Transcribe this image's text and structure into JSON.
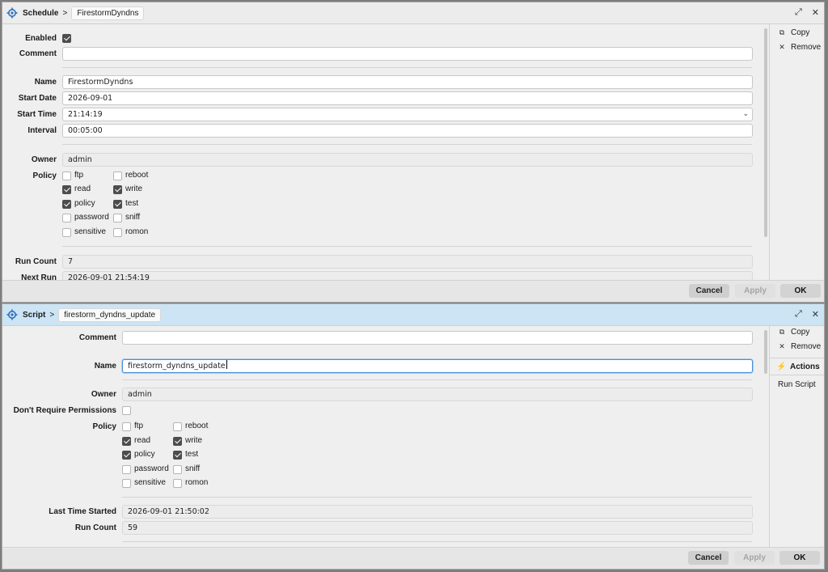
{
  "win1": {
    "path_root": "Schedule",
    "path_sep": ">",
    "path_item": "FirestormDyndns",
    "labels": {
      "enabled": "Enabled",
      "comment": "Comment",
      "name": "Name",
      "start_date": "Start Date",
      "start_time": "Start Time",
      "interval": "Interval",
      "owner": "Owner",
      "policy": "Policy",
      "run_count": "Run Count",
      "next_run": "Next Run"
    },
    "values": {
      "comment": "",
      "name": "FirestormDyndns",
      "start_date": "2026-09-01",
      "start_time": "21:14:19",
      "interval": "00:05:00",
      "owner": "admin",
      "run_count": "7",
      "next_run": "2026-09-01 21:54:19"
    },
    "policy": [
      {
        "label": "ftp",
        "checked": false
      },
      {
        "label": "reboot",
        "checked": false
      },
      {
        "label": "read",
        "checked": true
      },
      {
        "label": "write",
        "checked": true
      },
      {
        "label": "policy",
        "checked": true
      },
      {
        "label": "test",
        "checked": true
      },
      {
        "label": "password",
        "checked": false
      },
      {
        "label": "sniff",
        "checked": false
      },
      {
        "label": "sensitive",
        "checked": false
      },
      {
        "label": "romon",
        "checked": false
      }
    ],
    "side": {
      "copy": "Copy",
      "remove": "Remove"
    },
    "footer": {
      "cancel": "Cancel",
      "apply": "Apply",
      "ok": "OK"
    }
  },
  "win2": {
    "path_root": "Script",
    "path_sep": ">",
    "path_item": "firestorm_dyndns_update",
    "labels": {
      "comment": "Comment",
      "name": "Name",
      "owner": "Owner",
      "dont_require": "Don't Require Permissions",
      "policy": "Policy",
      "last_started": "Last Time Started",
      "run_count": "Run Count"
    },
    "values": {
      "comment": "",
      "name": "firestorm_dyndns_update",
      "owner": "admin",
      "last_started": "2026-09-01 21:50:02",
      "run_count": "59"
    },
    "policy": [
      {
        "label": "ftp",
        "checked": false
      },
      {
        "label": "reboot",
        "checked": false
      },
      {
        "label": "read",
        "checked": true
      },
      {
        "label": "write",
        "checked": true
      },
      {
        "label": "policy",
        "checked": true
      },
      {
        "label": "test",
        "checked": true
      },
      {
        "label": "password",
        "checked": false
      },
      {
        "label": "sniff",
        "checked": false
      },
      {
        "label": "sensitive",
        "checked": false
      },
      {
        "label": "romon",
        "checked": false
      }
    ],
    "side": {
      "copy": "Copy",
      "remove": "Remove",
      "actions": "Actions",
      "run_script": "Run Script"
    },
    "footer": {
      "cancel": "Cancel",
      "apply": "Apply",
      "ok": "OK"
    }
  },
  "icons": {
    "gear": "gear-icon",
    "restore": "restore-icon",
    "close": "close-icon",
    "copy": "copy-icon",
    "remove": "remove-icon",
    "actions": "actions-icon"
  },
  "colors": {
    "focus": "#4a90d9",
    "active_title": "#cce4f4",
    "checkbox_on": "#4d4d4d"
  }
}
